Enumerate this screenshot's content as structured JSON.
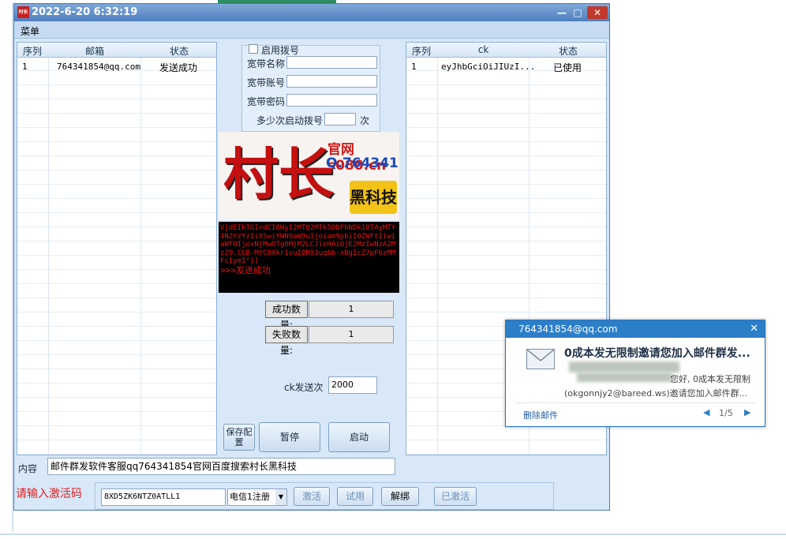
{
  "window": {
    "title": "2022-6-20 6:32:19",
    "app_icon": "村长",
    "min": "—",
    "max": "□",
    "close": "✕"
  },
  "menu": {
    "label": "菜单"
  },
  "left_table": {
    "headers": [
      "序列",
      "邮箱",
      "状态"
    ],
    "rows": [
      {
        "index": "1",
        "email": "764341854@qq.com",
        "status": "发送成功"
      }
    ]
  },
  "dial": {
    "enable_label": "启用拨号",
    "name_label": "宽带名称",
    "account_label": "宽带账号",
    "password_label": "宽带密码",
    "times_label": "多少次启动拨号",
    "times_unit": "次",
    "name_value": "",
    "account_value": "",
    "password_value": "",
    "times_value": ""
  },
  "logo": {
    "big": "村长",
    "url": "官网 s080.cn",
    "qq": "Q.764341854",
    "tag": "黑科技"
  },
  "console": {
    "text": "VjdEIkTGIrdCI6WyI2MTQ2MTk5ODFhNDk1OTAyMTY4N2YzYzIiXSwiYWN0aW9uIjoiam9pbiI0ZWFtIiwiaWFOIjoxNjMwOTg0MjM2LCJleHAiOjE2MzIwNzA2MzZ9.CCB-MYC0Xkr1vuIDR83uq6b-xBgIcZ7pF6zMMFcIymI\"}]",
    "result": ">>>发送成功"
  },
  "stats": {
    "success_label": "成功数量:",
    "success_value": "1",
    "fail_label": "失败数量:",
    "fail_value": "1"
  },
  "ck_send": {
    "label": "ck发送次",
    "value": "2000"
  },
  "buttons": {
    "save": "保存配置",
    "pause": "暂停",
    "start": "启动"
  },
  "right_table": {
    "headers": [
      "序列",
      "ck",
      "状态"
    ],
    "rows": [
      {
        "index": "1",
        "ck": "eyJhbGciOiJIUzI...",
        "status": "已使用"
      }
    ]
  },
  "content": {
    "label": "内容",
    "value": "邮件群发软件客服qq764341854官网百度搜索村长黑科技"
  },
  "activation": {
    "prompt": "请输入激活码",
    "code": "8XD5ZK6NTZ0ATLL1",
    "select": "电信1注册",
    "activate": "激活",
    "trial": "试用",
    "unbind": "解绑",
    "activated": "已激活"
  },
  "notification": {
    "sender": "764341854@qq.com",
    "subject": "0成本发无限制邀请您加入邮件群发...",
    "preview": "您好, 0成本发无限制",
    "from_line": "(okgonnjy2@bareed.ws)邀请您加入邮件群...",
    "delete": "删除邮件",
    "page": "1/5",
    "close": "✕"
  },
  "colors": {
    "title_bar": "#4f7fbf",
    "accent_red": "#e02020",
    "notify_blue": "#2c7ec7"
  }
}
